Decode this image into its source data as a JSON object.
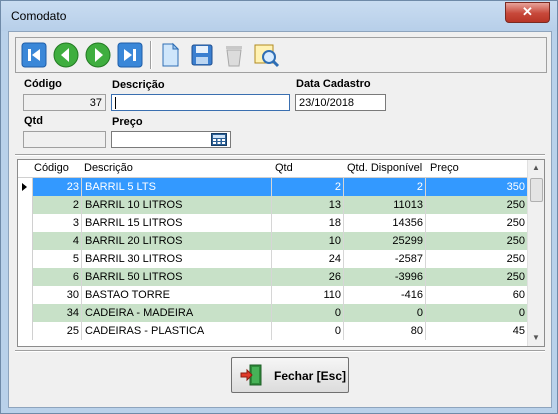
{
  "window": {
    "title": "Comodato",
    "close_glyph": "✕"
  },
  "toolbar": {
    "buttons": [
      "first-record-icon",
      "previous-record-icon",
      "next-record-icon",
      "last-record-icon",
      "new-document-icon",
      "save-icon",
      "delete-icon",
      "search-icon"
    ]
  },
  "form": {
    "codigo_label": "Código",
    "codigo_value": "37",
    "descricao_label": "Descrição",
    "descricao_value": "",
    "data_label": "Data Cadastro",
    "data_value": "23/10/2018",
    "qtd_label": "Qtd",
    "qtd_value": "",
    "preco_label": "Preço",
    "preco_value": ""
  },
  "grid": {
    "columns": [
      "Código",
      "Descrição",
      "Qtd",
      "Qtd. Disponível",
      "Preço"
    ],
    "rows": [
      {
        "codigo": "23",
        "descricao": "BARRIL  5 LTS",
        "qtd": "2",
        "disp": "2",
        "preco": "350"
      },
      {
        "codigo": "2",
        "descricao": "BARRIL 10 LITROS",
        "qtd": "13",
        "disp": "11013",
        "preco": "250"
      },
      {
        "codigo": "3",
        "descricao": "BARRIL 15 LITROS",
        "qtd": "18",
        "disp": "14356",
        "preco": "250"
      },
      {
        "codigo": "4",
        "descricao": "BARRIL 20 LITROS",
        "qtd": "10",
        "disp": "25299",
        "preco": "250"
      },
      {
        "codigo": "5",
        "descricao": "BARRIL 30 LITROS",
        "qtd": "24",
        "disp": "-2587",
        "preco": "250"
      },
      {
        "codigo": "6",
        "descricao": "BARRIL 50 LITROS",
        "qtd": "26",
        "disp": "-3996",
        "preco": "250"
      },
      {
        "codigo": "30",
        "descricao": "BASTAO TORRE",
        "qtd": "110",
        "disp": "-416",
        "preco": "60"
      },
      {
        "codigo": "34",
        "descricao": "CADEIRA - MADEIRA",
        "qtd": "0",
        "disp": "0",
        "preco": "0"
      },
      {
        "codigo": "25",
        "descricao": "CADEIRAS - PLASTICA",
        "qtd": "0",
        "disp": "80",
        "preco": "45"
      }
    ],
    "selected_row": 0,
    "colors": {
      "selected": "#3399ff",
      "alt": "#c8e1c8",
      "normal": "#ffffff"
    }
  },
  "footer": {
    "close_label": "Fechar [Esc]"
  }
}
